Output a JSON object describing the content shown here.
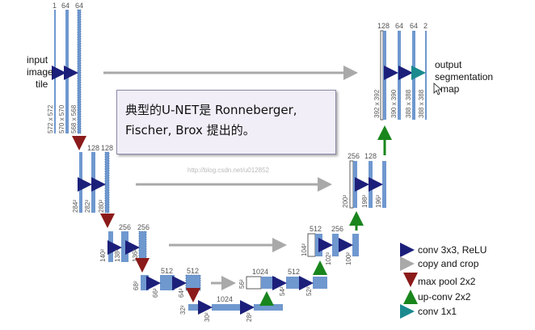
{
  "note": {
    "line1": "典型的U-NET是 Ronneberger,",
    "line2": "Fischer, Brox 提出的。"
  },
  "input_label": [
    "input",
    "image",
    "tile"
  ],
  "output_label": [
    "output",
    "segmentation",
    "map"
  ],
  "watermark": "http://blog.csdn.net/u012852",
  "colors": {
    "block": "#6f98cf",
    "block_edge": "#3e6aa5",
    "conv": "#1c1f7a",
    "copy": "#a9a9a9",
    "pool": "#8b1a1a",
    "upconv": "#19851d",
    "conv1x1": "#1a8a8f"
  },
  "legend": [
    {
      "type": "conv",
      "label": "conv 3x3, ReLU"
    },
    {
      "type": "copy",
      "label": "copy and crop"
    },
    {
      "type": "pool",
      "label": "max pool 2x2"
    },
    {
      "type": "upconv",
      "label": "up-conv 2x2"
    },
    {
      "type": "conv1x1",
      "label": "conv 1x1"
    }
  ],
  "channel_labels": [
    "1",
    "64",
    "64",
    "128",
    "128",
    "256",
    "256",
    "512",
    "512",
    "1024",
    "512",
    "256",
    "128",
    "128",
    "64",
    "64",
    "2"
  ],
  "size_labels": [
    "572 x 572",
    "570 x 570",
    "568 x 568",
    "284²",
    "282²",
    "280²",
    "140²",
    "138²",
    "136²",
    "68²",
    "66²",
    "64²",
    "32²",
    "30²",
    "28²",
    "56²",
    "54²",
    "52²",
    "104²",
    "102²",
    "100²",
    "200²",
    "198²",
    "196²",
    "392 x 392",
    "390 x 390",
    "388 x 388",
    "388 x 388"
  ]
}
